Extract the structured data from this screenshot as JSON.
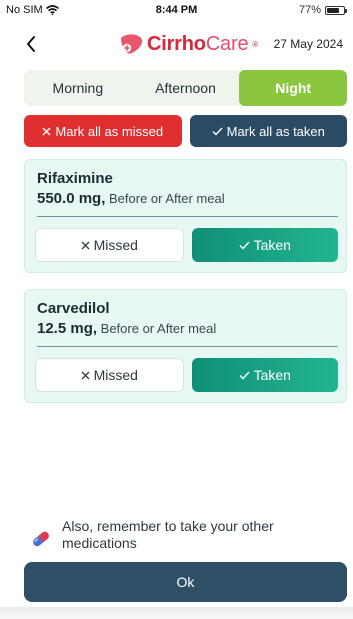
{
  "status_bar": {
    "carrier": "No SIM",
    "time": "8:44 PM",
    "battery_percent": "77%",
    "battery_level": 0.77
  },
  "header": {
    "logo_part1": "Cirrho",
    "logo_part2": "Care",
    "logo_reg": "®",
    "date": "27 May 2024"
  },
  "shifts": {
    "tabs": [
      "Morning",
      "Afternoon",
      "Night"
    ],
    "active": "Night"
  },
  "bulk_actions": {
    "missed_label": "Mark all as missed",
    "taken_label": "Mark all as taken"
  },
  "medications": [
    {
      "name": "Rifaximine",
      "dose": "550.0 mg,",
      "timing": "Before or After meal",
      "missed_label": "Missed",
      "taken_label": "Taken"
    },
    {
      "name": "Carvedilol",
      "dose": "12.5 mg,",
      "timing": "Before or After meal",
      "missed_label": "Missed",
      "taken_label": "Taken"
    }
  ],
  "reminder": {
    "line1": "Also, remember to take your other",
    "line2": "medications"
  },
  "footer": {
    "ok_label": "Ok"
  },
  "colors": {
    "night_active": "#8cc63f",
    "missed_red": "#df2f2f",
    "navy": "#2b4a63",
    "taken_teal": "#15a183",
    "card_bg": "#e7f8f2",
    "brand_red": "#d7263d"
  },
  "icons": {
    "back": "chevron-left-icon",
    "wifi": "wifi-icon",
    "battery": "battery-icon",
    "missed": "x-icon",
    "taken": "check-icon",
    "pill": "pill-capsule-icon",
    "logo": "liver-icon"
  }
}
